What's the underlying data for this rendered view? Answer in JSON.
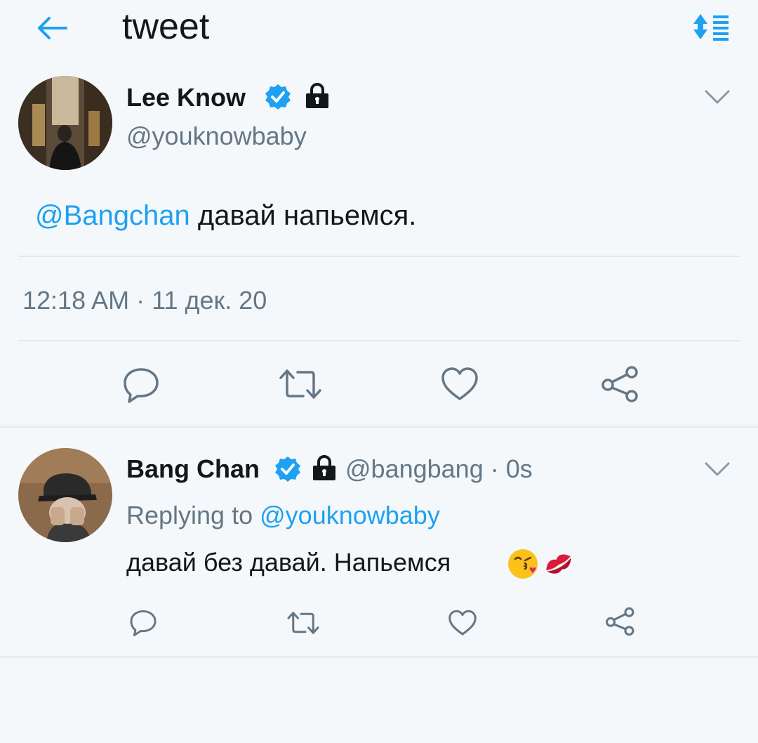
{
  "header": {
    "title": "tweet",
    "back_icon": "arrow-left-icon",
    "sort_icon": "sort-icon"
  },
  "colors": {
    "accent": "#1da1f2",
    "icon_gray": "#657786",
    "text": "#14171a",
    "background": "#f5f8fa"
  },
  "main_tweet": {
    "author_name": "Lee Know",
    "author_handle": "@youknowbaby",
    "mention": "@Bangchan",
    "text": "давай напьемся.",
    "meta": "12:18 AM · 11 дек. 20",
    "icons": [
      "verified-badge-icon",
      "lock-icon",
      "chevron-down-icon"
    ],
    "actions": [
      "reply-icon",
      "retweet-icon",
      "like-icon",
      "share-icon"
    ]
  },
  "reply_tweet": {
    "author_name": "Bang Chan",
    "author_handle": "@bangbang",
    "separator": "·",
    "time": "0s",
    "replying_prefix": "Replying to",
    "replying_to": "@youknowbaby",
    "text": "давай без давай. Напьемся",
    "emojis": [
      "kissing-face-icon",
      "kiss-mark-icon"
    ],
    "icons": [
      "verified-badge-icon",
      "lock-icon",
      "chevron-down-icon"
    ],
    "actions": [
      "reply-icon",
      "retweet-icon",
      "like-icon",
      "share-icon"
    ]
  }
}
